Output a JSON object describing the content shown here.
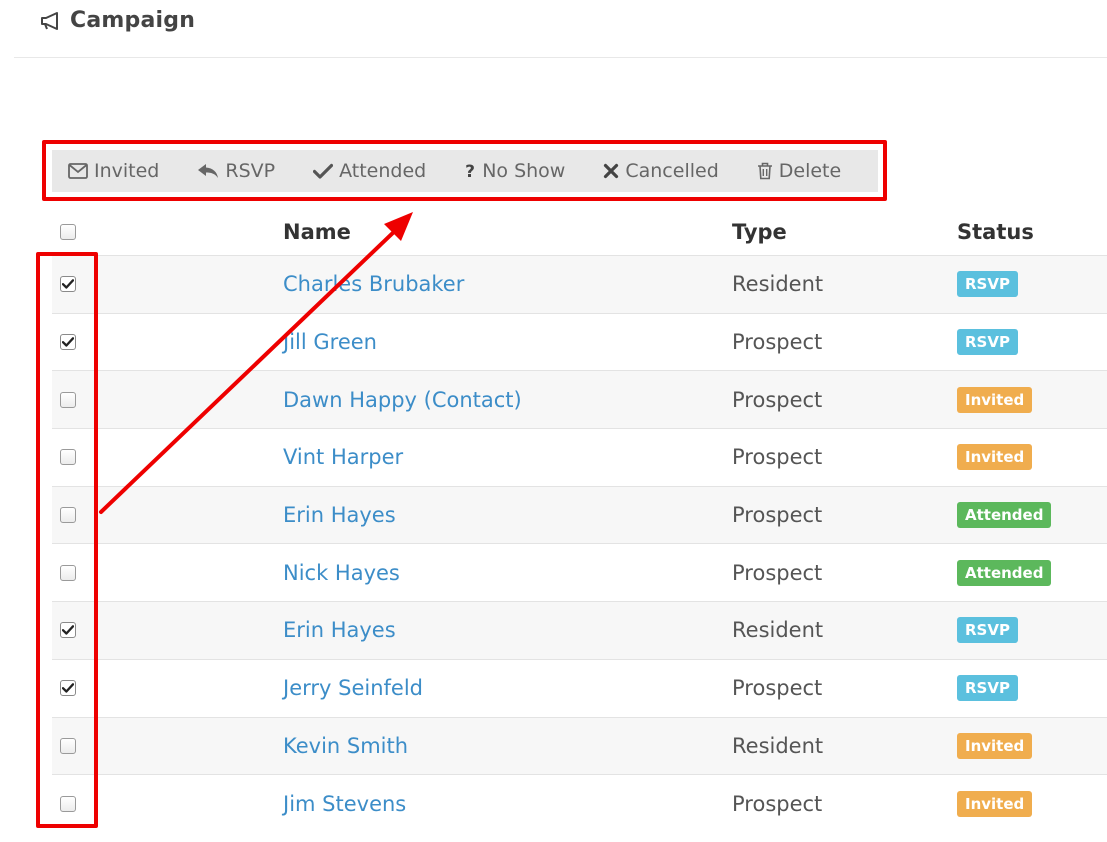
{
  "header": {
    "title": "Campaign",
    "icon": "bullhorn-icon"
  },
  "toolbar": {
    "buttons": [
      {
        "label": "Invited",
        "icon": "envelope-icon"
      },
      {
        "label": "RSVP",
        "icon": "reply-icon"
      },
      {
        "label": "Attended",
        "icon": "check-icon"
      },
      {
        "label": "No Show",
        "icon": "question-icon"
      },
      {
        "label": "Cancelled",
        "icon": "times-icon"
      },
      {
        "label": "Delete",
        "icon": "trash-icon"
      }
    ]
  },
  "table": {
    "headers": {
      "name": "Name",
      "type": "Type",
      "status": "Status"
    },
    "rows": [
      {
        "checked": true,
        "name": "Charles Brubaker",
        "type": "Resident",
        "status": "RSVP"
      },
      {
        "checked": true,
        "name": "Jill Green",
        "type": "Prospect",
        "status": "RSVP"
      },
      {
        "checked": false,
        "name": "Dawn Happy (Contact)",
        "type": "Prospect",
        "status": "Invited"
      },
      {
        "checked": false,
        "name": "Vint Harper",
        "type": "Prospect",
        "status": "Invited"
      },
      {
        "checked": false,
        "name": "Erin Hayes",
        "type": "Prospect",
        "status": "Attended"
      },
      {
        "checked": false,
        "name": "Nick Hayes",
        "type": "Prospect",
        "status": "Attended"
      },
      {
        "checked": true,
        "name": "Erin Hayes",
        "type": "Resident",
        "status": "RSVP"
      },
      {
        "checked": true,
        "name": "Jerry Seinfeld",
        "type": "Prospect",
        "status": "RSVP"
      },
      {
        "checked": false,
        "name": "Kevin Smith",
        "type": "Resident",
        "status": "Invited"
      },
      {
        "checked": false,
        "name": "Jim Stevens",
        "type": "Prospect",
        "status": "Invited"
      }
    ]
  },
  "colors": {
    "link": "#3c8dc8",
    "status": {
      "RSVP": "#5bc0de",
      "Invited": "#f0ad4e",
      "Attended": "#5cb85c"
    },
    "annotation": "#ee0000"
  }
}
